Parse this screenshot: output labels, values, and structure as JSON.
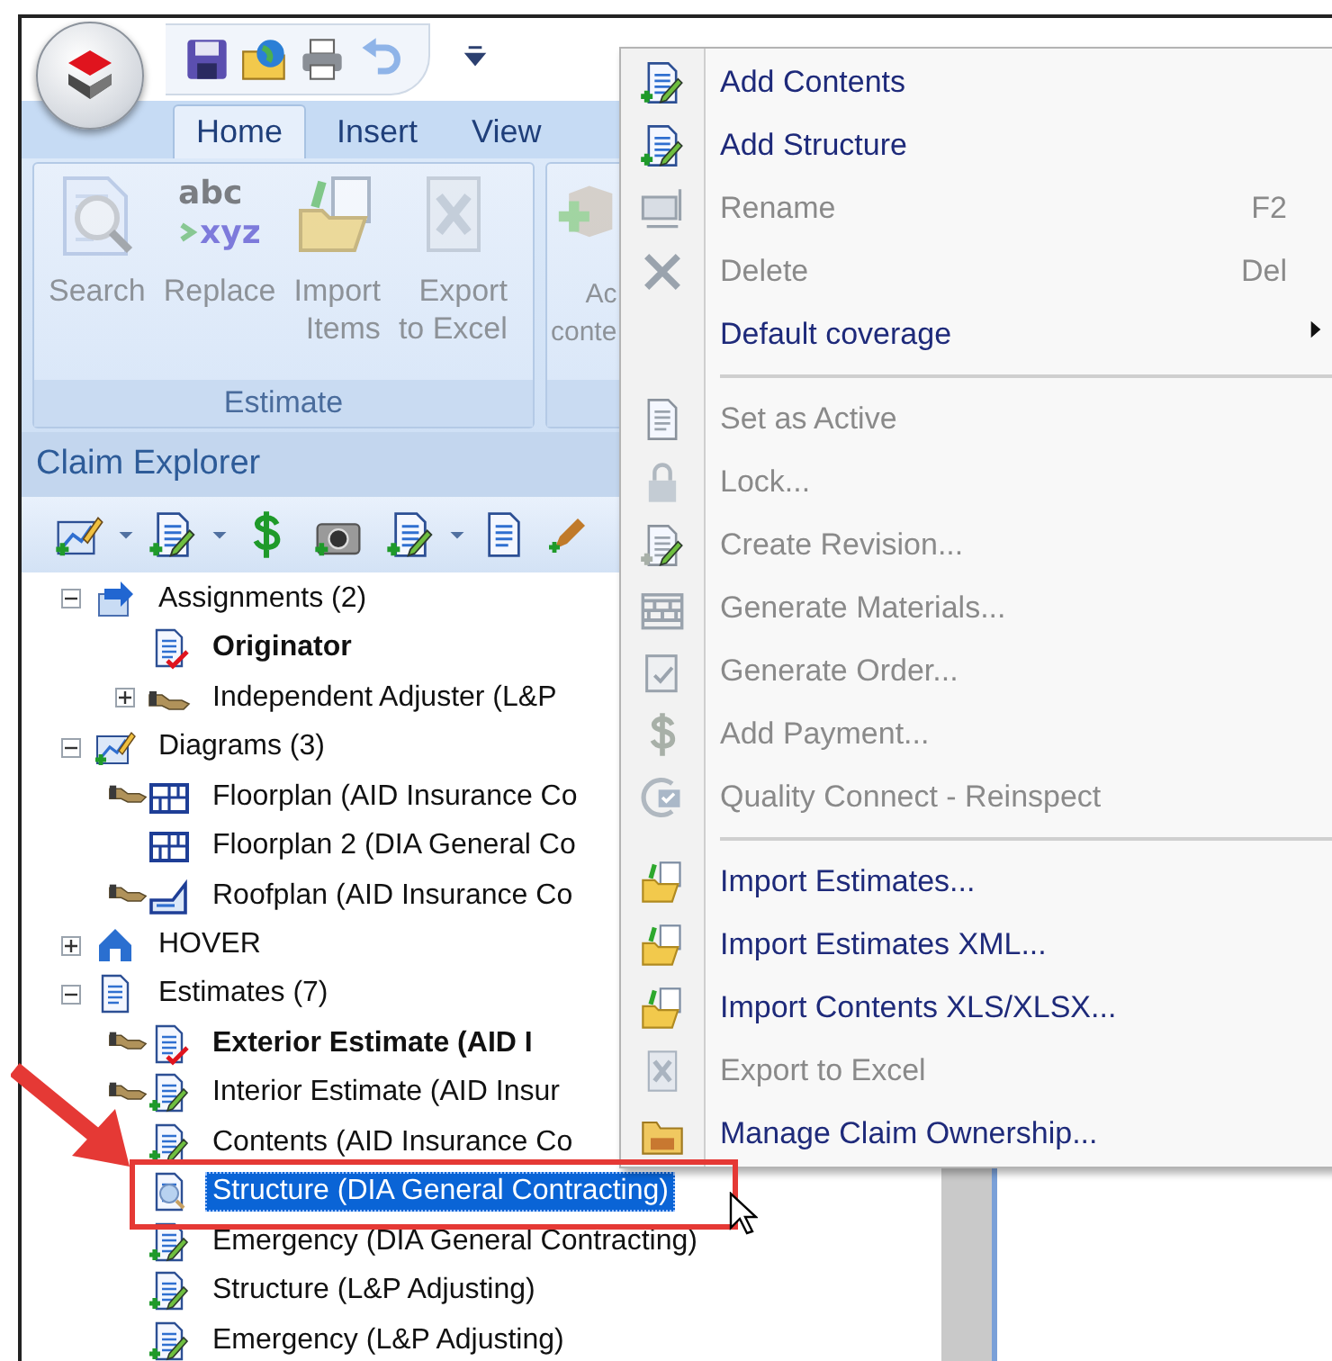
{
  "quick_access": {
    "customize": true
  },
  "ribbon": {
    "tabs": [
      {
        "label": "Home",
        "selected": true
      },
      {
        "label": "Insert",
        "selected": false
      },
      {
        "label": "View",
        "selected": false
      }
    ],
    "groups": [
      {
        "label": "Estimate",
        "buttons": [
          {
            "label": "Search",
            "disabled": true
          },
          {
            "label": "Replace",
            "disabled": true,
            "icon_text": [
              "abc",
              "xyz"
            ]
          },
          {
            "label": "Import\nItems",
            "disabled": true
          },
          {
            "label": "Export\nto Excel",
            "disabled": true
          }
        ]
      },
      {
        "buttons": [
          {
            "label": "Ac\nconte",
            "disabled": true
          }
        ]
      }
    ]
  },
  "explorer": {
    "title": "Claim Explorer"
  },
  "tree": [
    {
      "label": "Assignments (2)",
      "expanded": true,
      "bold": false,
      "selected": false,
      "children": [
        {
          "label": "Originator",
          "bold": true,
          "owned": false,
          "selected": false
        },
        {
          "label": "Independent Adjuster (L&P",
          "expanded": false,
          "bold": false,
          "selected": false
        }
      ]
    },
    {
      "label": "Diagrams (3)",
      "expanded": true,
      "bold": false,
      "selected": false,
      "children": [
        {
          "label": "Floorplan (AID Insurance Co",
          "bold": false,
          "owned": true,
          "selected": false
        },
        {
          "label": "Floorplan 2 (DIA General Co",
          "bold": false,
          "owned": false,
          "selected": false
        },
        {
          "label": "Roofplan (AID Insurance Co",
          "bold": false,
          "owned": true,
          "selected": false
        }
      ]
    },
    {
      "label": "HOVER",
      "expanded": false,
      "bold": false,
      "selected": false
    },
    {
      "label": "Estimates (7)",
      "expanded": true,
      "bold": false,
      "selected": false,
      "children": [
        {
          "label": "Exterior Estimate (AID I",
          "bold": true,
          "owned": true,
          "selected": false
        },
        {
          "label": "Interior Estimate (AID Insur",
          "bold": false,
          "owned": true,
          "selected": false
        },
        {
          "label": "Contents (AID Insurance Co",
          "bold": false,
          "owned": false,
          "selected": false
        },
        {
          "label": "Structure (DIA General Contracting)",
          "bold": false,
          "owned": false,
          "selected": true
        },
        {
          "label": "Emergency (DIA General Contracting)",
          "bold": false,
          "owned": false,
          "selected": false
        },
        {
          "label": "Structure (L&P Adjusting)",
          "bold": false,
          "owned": false,
          "selected": false
        },
        {
          "label": "Emergency (L&P Adjusting)",
          "bold": false,
          "owned": false,
          "selected": false
        }
      ]
    }
  ],
  "context_menu": {
    "items": [
      {
        "kind": "item",
        "label": "Add Contents",
        "disabled": false,
        "submenu": false
      },
      {
        "kind": "item",
        "label": "Add Structure",
        "disabled": false,
        "submenu": false
      },
      {
        "kind": "item",
        "label": "Rename",
        "shortcut": "F2",
        "disabled": true,
        "submenu": false
      },
      {
        "kind": "item",
        "label": "Delete",
        "shortcut": "Del",
        "disabled": true,
        "submenu": false
      },
      {
        "kind": "item",
        "label": "Default coverage",
        "disabled": false,
        "submenu": true
      },
      {
        "kind": "separator"
      },
      {
        "kind": "item",
        "label": "Set as Active",
        "disabled": true,
        "submenu": false
      },
      {
        "kind": "item",
        "label": "Lock...",
        "disabled": true,
        "submenu": false
      },
      {
        "kind": "item",
        "label": "Create Revision...",
        "disabled": true,
        "submenu": false
      },
      {
        "kind": "item",
        "label": "Generate Materials...",
        "disabled": true,
        "submenu": false
      },
      {
        "kind": "item",
        "label": "Generate Order...",
        "disabled": true,
        "submenu": false
      },
      {
        "kind": "item",
        "label": "Add Payment...",
        "disabled": true,
        "submenu": false
      },
      {
        "kind": "item",
        "label": "Quality Connect - Reinspect",
        "disabled": true,
        "submenu": false
      },
      {
        "kind": "separator"
      },
      {
        "kind": "item",
        "label": "Import Estimates...",
        "disabled": false,
        "submenu": false
      },
      {
        "kind": "item",
        "label": "Import Estimates XML...",
        "disabled": false,
        "submenu": false
      },
      {
        "kind": "item",
        "label": "Import Contents XLS/XLSX...",
        "disabled": false,
        "submenu": false
      },
      {
        "kind": "item",
        "label": "Export to Excel",
        "disabled": true,
        "submenu": false
      },
      {
        "kind": "item",
        "label": "Manage Claim Ownership...",
        "disabled": false,
        "submenu": false
      }
    ]
  }
}
